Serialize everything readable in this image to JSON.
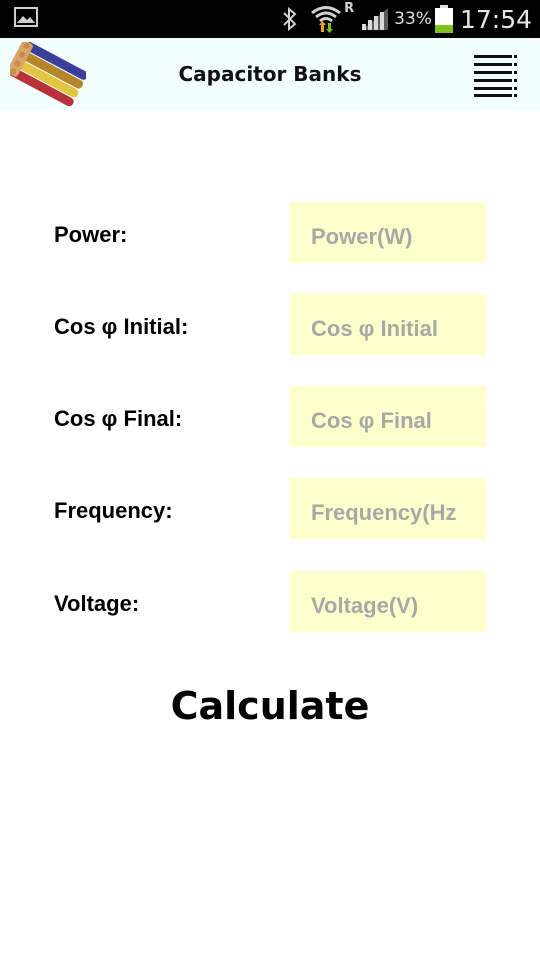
{
  "status_bar": {
    "icons": [
      "gallery-notification-icon",
      "bluetooth-icon",
      "wifi-icon",
      "roaming-icon",
      "signal-icon",
      "battery-icon"
    ],
    "roaming_label": "R",
    "battery_percent": "33%",
    "battery_level": 0.33,
    "time": "17:54"
  },
  "app_bar": {
    "title": "Capacitor Banks",
    "logo_icon": "cables-logo-icon",
    "menu_icon": "menu-icon"
  },
  "form": {
    "fields": [
      {
        "label": "Power:",
        "placeholder": "Power(W)",
        "value": ""
      },
      {
        "label": "Cos φ Initial:",
        "placeholder": "Cos φ Initial",
        "value": ""
      },
      {
        "label": "Cos φ Final:",
        "placeholder": "Cos φ Final",
        "value": ""
      },
      {
        "label": "Frequency:",
        "placeholder": "Frequency(Hz",
        "value": ""
      },
      {
        "label": "Voltage:",
        "placeholder": "Voltage(V)",
        "value": ""
      }
    ]
  },
  "actions": {
    "calculate_label": "Calculate"
  },
  "colors": {
    "status_bar_bg": "#000000",
    "app_bar_bg": "#f3fefe",
    "input_bg": "#ffffcc",
    "placeholder_text": "#a8a8a8",
    "battery_fill": "#7ec21e"
  }
}
